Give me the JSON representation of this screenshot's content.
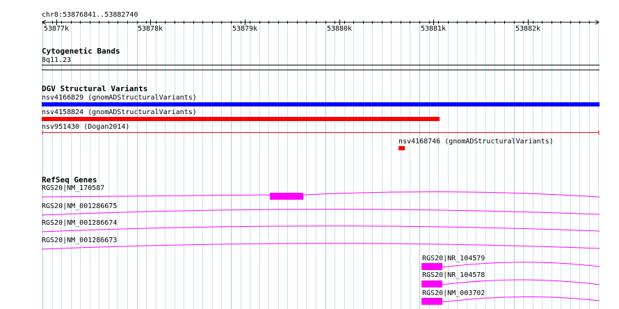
{
  "location": "chr8:53876841..53882740",
  "ruler": {
    "ticks": [
      "53877k",
      "53878k",
      "53879k",
      "53880k",
      "53881k",
      "53882k"
    ]
  },
  "tracks": {
    "cytoband": {
      "title": "Cytogenetic Bands",
      "band": "8q11.23"
    },
    "dgv": {
      "title": "DGV Structural Variants",
      "features": [
        {
          "label": "nsv4166829 (gnomADStructuralVariants)",
          "color": "#0000ff"
        },
        {
          "label": "nsv4158824 (gnomADStructuralVariants)",
          "color": "#ff0000"
        },
        {
          "label": "nsv951430 (Dogan2014)",
          "color": "#ff0000"
        },
        {
          "label": "nsv4168746 (gnomADStructuralVariants)",
          "color": "#ff0000"
        }
      ]
    },
    "refseq": {
      "title": "RefSeq Genes",
      "color": "#ff00ff",
      "genes": [
        {
          "label": "RGS20|NM_170587"
        },
        {
          "label": "RGS20|NM_001286675"
        },
        {
          "label": "RGS20|NM_001286674"
        },
        {
          "label": "RGS20|NM_001286673"
        },
        {
          "label": "RGS20|NR_104579"
        },
        {
          "label": "RGS20|NR_104578"
        },
        {
          "label": "RGS20|NM_003702"
        }
      ]
    }
  }
}
